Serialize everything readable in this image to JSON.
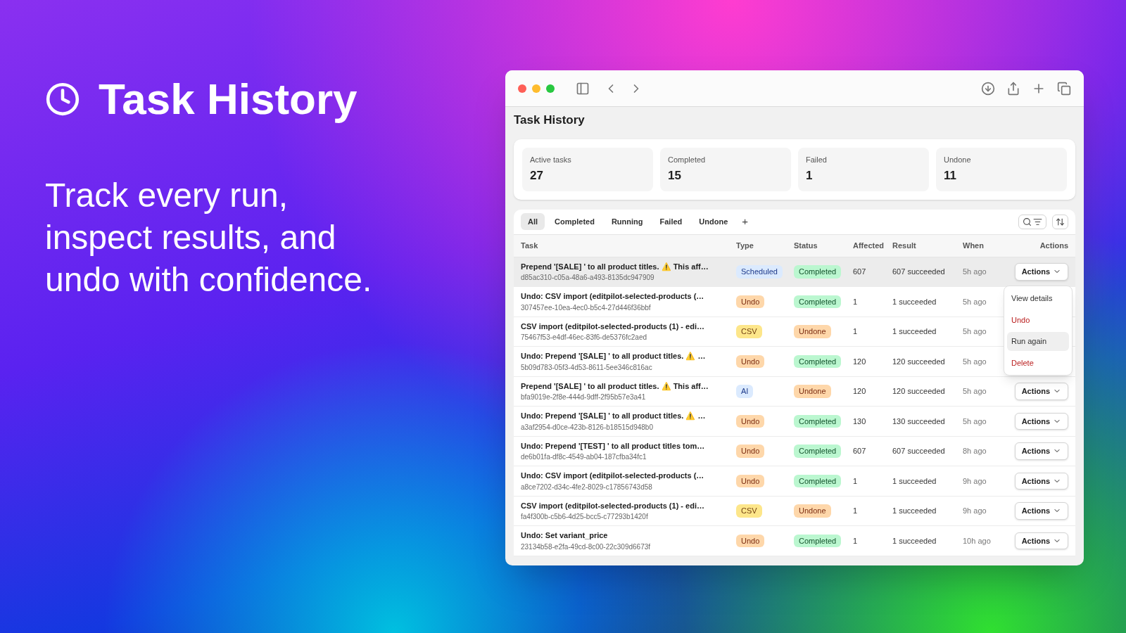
{
  "hero": {
    "title": "Task History",
    "tagline": "Track every run, inspect results, and undo with confidence."
  },
  "page": {
    "title": "Task History"
  },
  "stats": [
    {
      "label": "Active tasks",
      "value": "27"
    },
    {
      "label": "Completed",
      "value": "15"
    },
    {
      "label": "Failed",
      "value": "1"
    },
    {
      "label": "Undone",
      "value": "11"
    }
  ],
  "tabs": [
    {
      "label": "All",
      "selected": true
    },
    {
      "label": "Completed",
      "selected": false
    },
    {
      "label": "Running",
      "selected": false
    },
    {
      "label": "Failed",
      "selected": false
    },
    {
      "label": "Undone",
      "selected": false
    }
  ],
  "add_tab": "+",
  "table": {
    "columns": [
      "Task",
      "Type",
      "Status",
      "Affected",
      "Result",
      "When",
      "Actions"
    ],
    "rows": [
      {
        "title": "Prepend '[SALE] ' to all product titles. ⚠️ This aff…",
        "id": "d85ac310-c05a-48a6-a493-8135dc947909",
        "type": {
          "label": "Scheduled",
          "kind": "scheduled"
        },
        "status": {
          "label": "Completed",
          "kind": "completed"
        },
        "affected": "607",
        "result": "607 succeeded",
        "when": "5h ago",
        "actions": "Actions",
        "selected": true
      },
      {
        "title": "Undo: CSV import (editpilot-selected-products (…",
        "id": "307457ee-10ea-4ec0-b5c4-27d446f36bbf",
        "type": {
          "label": "Undo",
          "kind": "undo"
        },
        "status": {
          "label": "Completed",
          "kind": "completed"
        },
        "affected": "1",
        "result": "1 succeeded",
        "when": "5h ago",
        "selected": false
      },
      {
        "title": "CSV import (editpilot-selected-products (1) - edi…",
        "id": "75467f53-e4df-46ec-83f6-de5376fc2aed",
        "type": {
          "label": "CSV",
          "kind": "csv"
        },
        "status": {
          "label": "Undone",
          "kind": "undone"
        },
        "affected": "1",
        "result": "1 succeeded",
        "when": "5h ago",
        "selected": false
      },
      {
        "title": "Undo: Prepend '[SALE] ' to all product titles. ⚠️ …",
        "id": "5b09d783-05f3-4d53-8611-5ee346c816ac",
        "type": {
          "label": "Undo",
          "kind": "undo"
        },
        "status": {
          "label": "Completed",
          "kind": "completed"
        },
        "affected": "120",
        "result": "120 succeeded",
        "when": "5h ago",
        "selected": false
      },
      {
        "title": "Prepend '[SALE] ' to all product titles. ⚠️ This aff…",
        "id": "bfa9019e-2f8e-444d-9dff-2f95b57e3a41",
        "type": {
          "label": "AI",
          "kind": "ai"
        },
        "status": {
          "label": "Undone",
          "kind": "undone"
        },
        "affected": "120",
        "result": "120 succeeded",
        "when": "5h ago",
        "actions": "Actions",
        "selected": false
      },
      {
        "title": "Undo: Prepend '[SALE] ' to all product titles. ⚠️ …",
        "id": "a3af2954-d0ce-423b-8126-b18515d948b0",
        "type": {
          "label": "Undo",
          "kind": "undo"
        },
        "status": {
          "label": "Completed",
          "kind": "completed"
        },
        "affected": "130",
        "result": "130 succeeded",
        "when": "5h ago",
        "actions": "Actions",
        "selected": false
      },
      {
        "title": "Undo: Prepend '[TEST] ' to all product titles tom…",
        "id": "de6b01fa-df8c-4549-ab04-187cfba34fc1",
        "type": {
          "label": "Undo",
          "kind": "undo"
        },
        "status": {
          "label": "Completed",
          "kind": "completed"
        },
        "affected": "607",
        "result": "607 succeeded",
        "when": "8h ago",
        "actions": "Actions",
        "selected": false
      },
      {
        "title": "Undo: CSV import (editpilot-selected-products (…",
        "id": "a8ce7202-d34c-4fe2-8029-c17856743d58",
        "type": {
          "label": "Undo",
          "kind": "undo"
        },
        "status": {
          "label": "Completed",
          "kind": "completed"
        },
        "affected": "1",
        "result": "1 succeeded",
        "when": "9h ago",
        "actions": "Actions",
        "selected": false
      },
      {
        "title": "CSV import (editpilot-selected-products (1) - edi…",
        "id": "fa4f300b-c5b6-4d25-bcc5-c77293b1420f",
        "type": {
          "label": "CSV",
          "kind": "csv"
        },
        "status": {
          "label": "Undone",
          "kind": "undone"
        },
        "affected": "1",
        "result": "1 succeeded",
        "when": "9h ago",
        "actions": "Actions",
        "selected": false
      },
      {
        "title": "Undo: Set variant_price",
        "id": "23134b58-e2fa-49cd-8c00-22c309d6673f",
        "type": {
          "label": "Undo",
          "kind": "undo"
        },
        "status": {
          "label": "Completed",
          "kind": "completed"
        },
        "affected": "1",
        "result": "1 succeeded",
        "when": "10h ago",
        "actions": "Actions",
        "selected": false
      }
    ]
  },
  "menu": {
    "items": [
      {
        "label": "View details",
        "kind": "normal",
        "selected": false
      },
      {
        "label": "Undo",
        "kind": "danger",
        "selected": false
      },
      {
        "label": "Run again",
        "kind": "normal",
        "selected": true
      },
      {
        "label": "Delete",
        "kind": "danger",
        "selected": false
      }
    ]
  }
}
